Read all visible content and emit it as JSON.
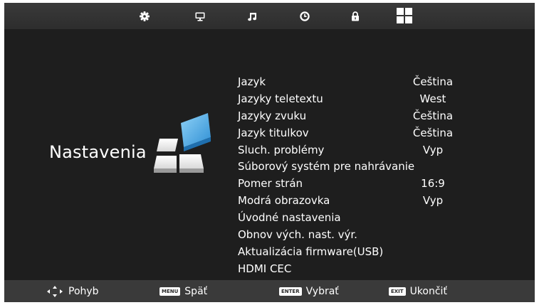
{
  "topbar": {
    "tabs": [
      {
        "icon": "gear-icon"
      },
      {
        "icon": "monitor-icon"
      },
      {
        "icon": "music-note-icon"
      },
      {
        "icon": "clock-icon"
      },
      {
        "icon": "lock-icon"
      },
      {
        "icon": "grid-icon",
        "selected": true
      }
    ]
  },
  "section": {
    "title": "Nastavenia",
    "icon": "settings-blocks-icon"
  },
  "menu": {
    "items": [
      {
        "label": "Jazyk",
        "value": "Čeština"
      },
      {
        "label": "Jazyky teletextu",
        "value": "West"
      },
      {
        "label": "Jazyky zvuku",
        "value": "Čeština"
      },
      {
        "label": "Jazyk titulkov",
        "value": "Čeština"
      },
      {
        "label": "Sluch. problémy",
        "value": "Vyp"
      },
      {
        "label": "Súborový systém pre nahrávanie",
        "value": ""
      },
      {
        "label": "Pomer strán",
        "value": "16:9"
      },
      {
        "label": "Modrá obrazovka",
        "value": "Vyp"
      },
      {
        "label": "Úvodné nastavenia",
        "value": ""
      },
      {
        "label": "Obnov vých. nast. výr.",
        "value": ""
      },
      {
        "label": "Aktualizácia firmware(USB)",
        "value": ""
      },
      {
        "label": "HDMI CEC",
        "value": ""
      }
    ]
  },
  "bottombar": {
    "move": {
      "icon": "dpad-arrows-icon",
      "label": "Pohyb"
    },
    "back": {
      "key": "MENU",
      "label": "Späť"
    },
    "select": {
      "key": "ENTER",
      "label": "Vybrať"
    },
    "exit": {
      "key": "EXIT",
      "label": "Ukončiť"
    }
  },
  "colors": {
    "background": "#1e1e1e",
    "bar": "#3a3a3a",
    "text": "#ffffff",
    "accent": "#3aa0e0"
  }
}
